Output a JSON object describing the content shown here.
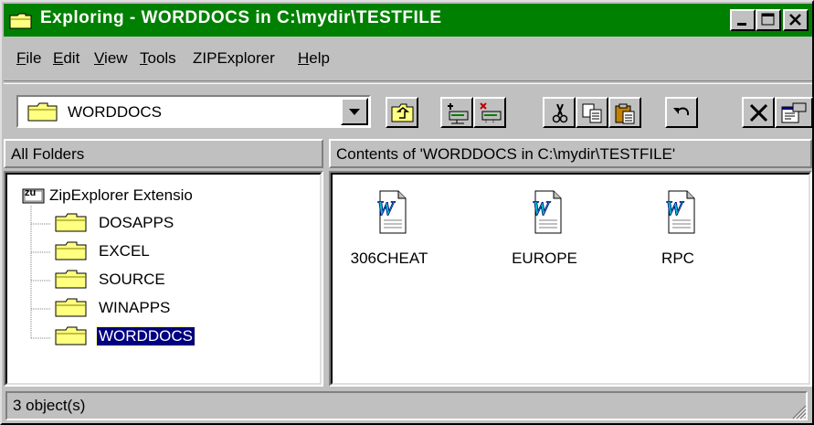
{
  "window": {
    "title": "Exploring - WORDDOCS in C:\\mydir\\TESTFILE"
  },
  "menu": [
    {
      "label": "File",
      "key": "F",
      "rest": "ile"
    },
    {
      "label": "Edit",
      "key": "E",
      "rest": "dit"
    },
    {
      "label": "View",
      "key": "V",
      "rest": "iew"
    },
    {
      "label": "Tools",
      "key": "T",
      "rest": "ools"
    },
    {
      "label": "ZIPExplorer",
      "key": "",
      "rest": "ZIPExplorer"
    },
    {
      "label": "Help",
      "key": "H",
      "rest": "elp"
    }
  ],
  "toolbar": {
    "location_value": "WORDDOCS",
    "buttons": [
      "up-one-level-icon",
      "map-network-drive-icon",
      "disconnect-network-drive-icon",
      "cut-icon",
      "copy-icon",
      "paste-icon",
      "undo-icon",
      "delete-icon",
      "properties-icon"
    ]
  },
  "left_pane": {
    "header": "All Folders",
    "root": "ZipExplorer Extensio",
    "folders": [
      "DOSAPPS",
      "EXCEL",
      "SOURCE",
      "WINAPPS",
      "WORDDOCS"
    ],
    "selected": "WORDDOCS"
  },
  "right_pane": {
    "header": "Contents of 'WORDDOCS in C:\\mydir\\TESTFILE'",
    "files": [
      "306CHEAT",
      "EUROPE",
      "RPC"
    ]
  },
  "status": {
    "text": "3 object(s)"
  },
  "colors": {
    "titlebar": "#008000",
    "face": "#c0c0c0",
    "selection": "#000080",
    "folder": "#ffff80"
  }
}
